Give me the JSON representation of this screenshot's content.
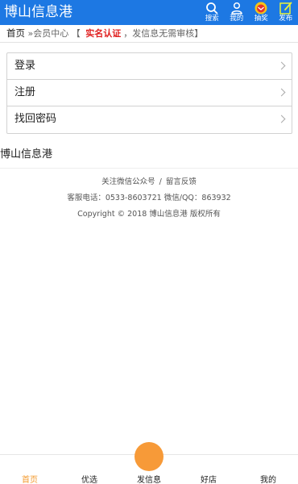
{
  "header": {
    "site_title": "博山信息港",
    "actions": [
      {
        "label": "搜索",
        "icon": "search-icon"
      },
      {
        "label": "我的",
        "icon": "user-icon"
      },
      {
        "label": "抽奖",
        "icon": "lottery-icon"
      },
      {
        "label": "发布",
        "icon": "edit-icon"
      }
    ]
  },
  "breadcrumb": {
    "home": "首页",
    "separator": "»",
    "current": "会员中心",
    "bracket_open": "【",
    "verify_link": "实名认证",
    "notice": "，发信息无需审核",
    "bracket_close": "】"
  },
  "menu": [
    {
      "label": "登录"
    },
    {
      "label": "注册"
    },
    {
      "label": "找回密码"
    }
  ],
  "brand_text": "博山信息港",
  "footer": {
    "follow_wechat": "关注微信公众号",
    "divider": "/",
    "feedback": "留言反馈",
    "contact": "客服电话：0533-8603721 微信/QQ：863932",
    "copyright": "Copyright © 2018 博山信息港 版权所有"
  },
  "bottom_nav": [
    {
      "label": "首页"
    },
    {
      "label": "优选"
    },
    {
      "label": "发信息"
    },
    {
      "label": "好店"
    },
    {
      "label": "我的"
    }
  ],
  "colors": {
    "header_bg": "#1d78e3",
    "accent_orange": "#f79a38",
    "verify_red": "#e02020"
  }
}
